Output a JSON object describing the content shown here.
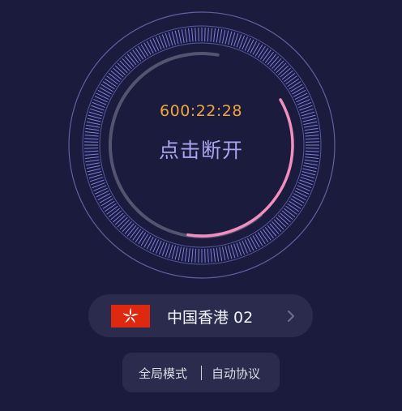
{
  "connection": {
    "timer": "600:22:28",
    "disconnect_label": "点击断开",
    "progress": 0.33
  },
  "server": {
    "name": "中国香港 02",
    "flag_icon": "hong-kong-flag-icon"
  },
  "mode": {
    "global_label": "全局模式",
    "protocol_label": "自动协议"
  },
  "colors": {
    "background": "#1b1c3d",
    "panel": "#2a2b4d",
    "timer": "#f0a53b",
    "accent_text": "#a7a6ef",
    "ring": "#7f7fe6",
    "progress": "#f08fc0"
  }
}
